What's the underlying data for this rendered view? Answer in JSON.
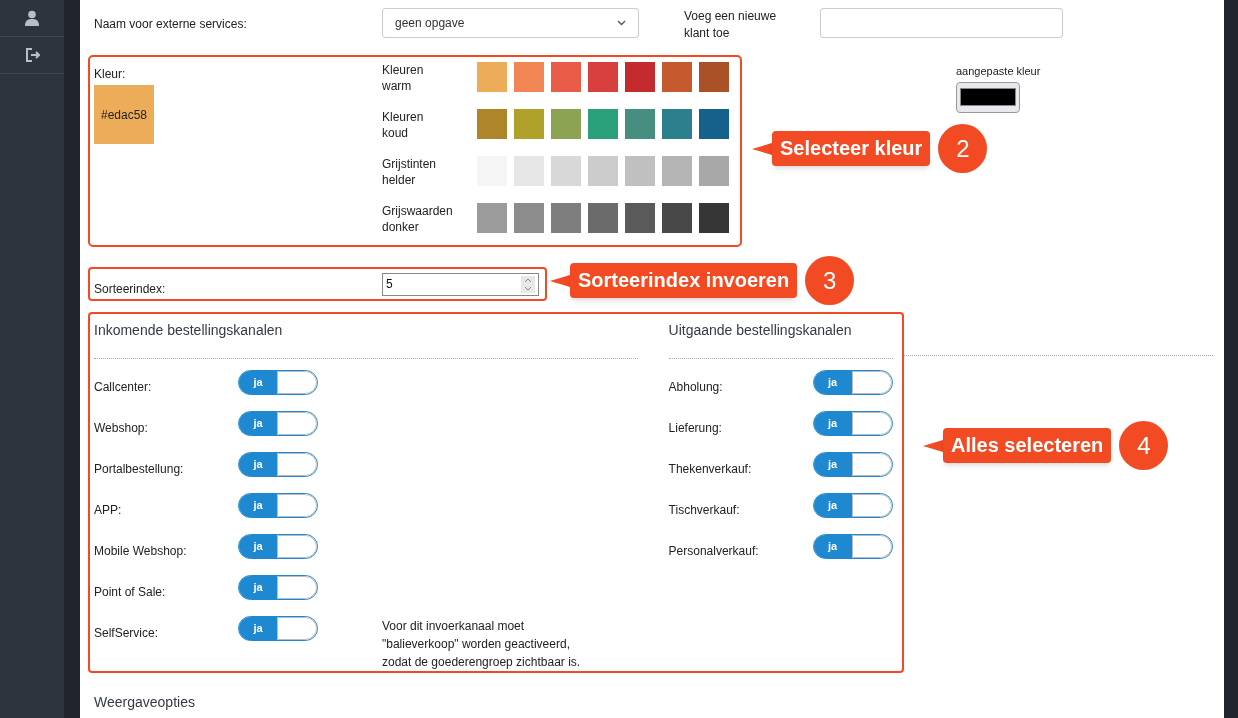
{
  "external_name": {
    "label": "Naam voor externe services:",
    "value": "geen opgave"
  },
  "new_customer": {
    "label": "Voeg een nieuwe klant toe"
  },
  "color": {
    "label": "Kleur:",
    "value": "#edac58",
    "color": "#edac58",
    "groups": [
      {
        "label": "Kleuren warm",
        "swatches": [
          {
            "color": "#edac58"
          },
          {
            "color": "#f28554"
          },
          {
            "color": "#e95c48"
          },
          {
            "color": "#d83f3f"
          },
          {
            "color": "#c42b2e"
          },
          {
            "color": "#c45a2e"
          },
          {
            "color": "#ab5128"
          }
        ]
      },
      {
        "label": "Kleuren koud",
        "swatches": [
          {
            "color": "#ae8629"
          },
          {
            "color": "#b0a12b"
          },
          {
            "color": "#8ca353"
          },
          {
            "color": "#29a07a"
          },
          {
            "color": "#468f80"
          },
          {
            "color": "#2c7f8c"
          },
          {
            "color": "#15618b"
          }
        ]
      },
      {
        "label": "Grijstinten helder",
        "swatches": [
          {
            "color": "#f5f5f5"
          },
          {
            "color": "#e6e6e6"
          },
          {
            "color": "#d8d8d8"
          },
          {
            "color": "#cccccc"
          },
          {
            "color": "#c0c0c0"
          },
          {
            "color": "#b4b4b4"
          },
          {
            "color": "#a8a8a8"
          }
        ]
      },
      {
        "label": "Grijswaarden donker",
        "swatches": [
          {
            "color": "#9b9b9b"
          },
          {
            "color": "#8c8c8c"
          },
          {
            "color": "#7d7d7d"
          },
          {
            "color": "#6b6b6b"
          },
          {
            "color": "#5a5a5a"
          },
          {
            "color": "#484848"
          },
          {
            "color": "#363636"
          }
        ]
      }
    ],
    "custom": {
      "label": "aangepaste kleur",
      "color": "#000000"
    }
  },
  "sort_index": {
    "label": "Sorteerindex:",
    "value": "5"
  },
  "incoming": {
    "title": "Inkomende bestellingskanalen",
    "channels": [
      {
        "label": "Callcenter:",
        "on": true,
        "toggle_text": "ja"
      },
      {
        "label": "Webshop:",
        "on": true,
        "toggle_text": "ja"
      },
      {
        "label": "Portalbestellung:",
        "on": true,
        "toggle_text": "ja"
      },
      {
        "label": "APP:",
        "on": true,
        "toggle_text": "ja"
      },
      {
        "label": "Mobile Webshop:",
        "on": true,
        "toggle_text": "ja"
      },
      {
        "label": "Point of Sale:",
        "on": true,
        "toggle_text": "ja"
      },
      {
        "label": "SelfService:",
        "on": true,
        "toggle_text": "ja",
        "note": "Voor dit invoerkanaal moet \"balieverkoop\" worden geactiveerd, zodat de goederengroep zichtbaar is."
      }
    ]
  },
  "outgoing": {
    "title": "Uitgaande bestellingskanalen",
    "channels": [
      {
        "label": "Abholung:",
        "on": true,
        "toggle_text": "ja"
      },
      {
        "label": "Lieferung:",
        "on": true,
        "toggle_text": "ja"
      },
      {
        "label": "Thekenverkauf:",
        "on": true,
        "toggle_text": "ja"
      },
      {
        "label": "Tischverkauf:",
        "on": true,
        "toggle_text": "ja"
      },
      {
        "label": "Personalverkauf:",
        "on": true,
        "toggle_text": "ja"
      }
    ]
  },
  "display_options": {
    "title": "Weergaveopties"
  },
  "callouts": [
    {
      "text": "Selecteer kleur",
      "step": "2"
    },
    {
      "text": "Sorteerindex invoeren",
      "step": "3"
    },
    {
      "text": "Alles selecteren",
      "step": "4"
    }
  ]
}
